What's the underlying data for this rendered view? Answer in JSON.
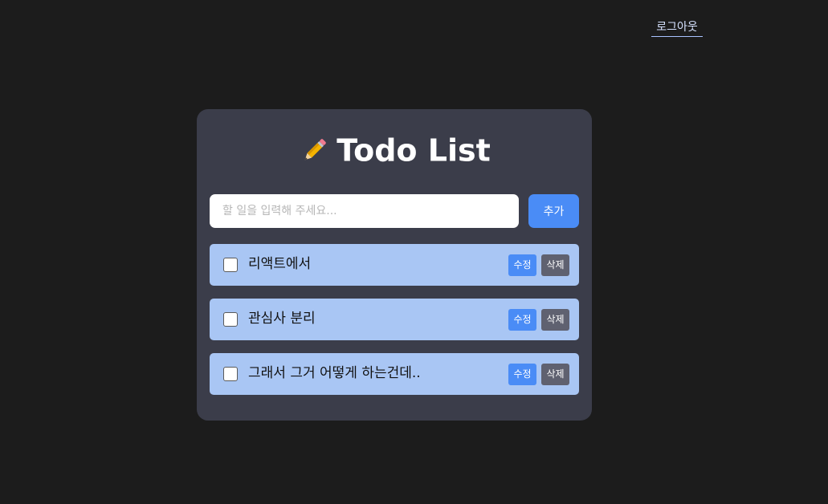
{
  "header": {
    "logout_label": "로그아웃"
  },
  "card": {
    "title": "Todo List",
    "title_icon": "pencil-icon",
    "input": {
      "value": "",
      "placeholder": "할 일을 입력해 주세요..."
    },
    "add_label": "추가"
  },
  "todos": [
    {
      "text": "리액트에서",
      "checked": false,
      "edit_label": "수정",
      "delete_label": "삭제"
    },
    {
      "text": "관심사 분리",
      "checked": false,
      "edit_label": "수정",
      "delete_label": "삭제"
    },
    {
      "text": "그래서 그거 어떻게 하는건데..",
      "checked": false,
      "edit_label": "수정",
      "delete_label": "삭제"
    }
  ],
  "colors": {
    "background": "#1c1c1c",
    "card": "#3b3d4a",
    "accent": "#4a8cf6",
    "item": "#a9c6f4",
    "delete": "#5f6170"
  }
}
